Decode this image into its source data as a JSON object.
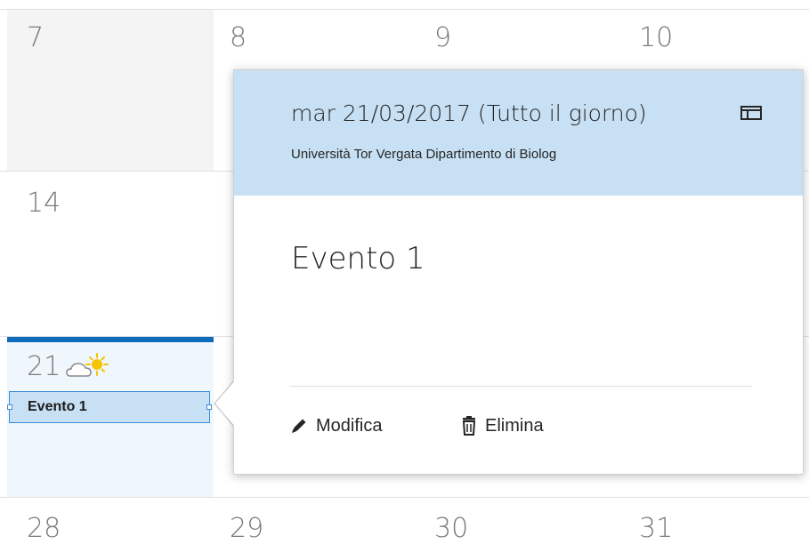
{
  "calendar": {
    "days": {
      "d7": "7",
      "d8": "8",
      "d9": "9",
      "d10": "10",
      "d14": "14",
      "d21": "21",
      "d28": "28",
      "d29": "29",
      "d30": "30",
      "d31": "31"
    },
    "today_event": {
      "label": "Evento 1"
    },
    "weather_icon": "partly-sunny-icon"
  },
  "callout": {
    "date": "mar 21/03/2017 (Tutto il giorno)",
    "location": "Università Tor Vergata Dipartimento di Biolog",
    "title": "Evento 1",
    "actions": {
      "edit_label": "Modifica",
      "delete_label": "Elimina"
    },
    "icons": {
      "expand": "expand-window-icon",
      "edit": "pencil-icon",
      "delete": "trash-icon"
    }
  },
  "colors": {
    "header_bg": "#c7e0f4",
    "today_accent": "#0f6cbd",
    "event_chip_border": "#3a8fd9"
  }
}
